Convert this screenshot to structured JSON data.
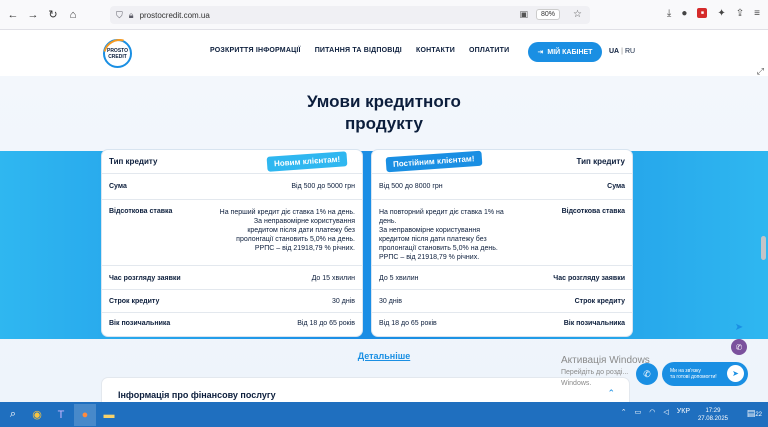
{
  "browser": {
    "url": "prostocredit.com.ua",
    "zoom": "80%"
  },
  "header": {
    "logo_line1": "PROSTO",
    "logo_line2": "CREDIT",
    "nav": [
      "РОЗКРИТТЯ ІНФОРМАЦІЇ",
      "ПИТАННЯ ТА ВІДПОВІДІ",
      "КОНТАКТИ",
      "ОПЛАТИТИ"
    ],
    "cabinet_label": "МІЙ КАБІНЕТ",
    "lang_ua": "UA",
    "lang_sep": "|",
    "lang_ru": "RU"
  },
  "main": {
    "heading_line1": "Умови кредитного",
    "heading_line2": "продукту",
    "new_clients": {
      "tag": "Новим клієнтам!",
      "rows": [
        {
          "label": "Тип кредиту",
          "value": ""
        },
        {
          "label": "Сума",
          "value": "Від 500 до 5000 грн"
        },
        {
          "label": "Відсоткова ставка",
          "value_lines": [
            "На перший кредит діє ставка 1% на день.",
            "За неправомірне користування",
            "кредитом після дати платежу без",
            "пролонгації становить 5,0% на день.",
            "РРПС – від 21918,79 % річних."
          ]
        },
        {
          "label": "Час розгляду заявки",
          "value": "До 15 хвилин"
        },
        {
          "label": "Строк кредиту",
          "value": "30 днів"
        },
        {
          "label": "Вік позичальника",
          "value": "Від 18 до 65 років"
        }
      ]
    },
    "regular_clients": {
      "tag": "Постійним клієнтам!",
      "rows": [
        {
          "label": "Тип кредиту",
          "value": ""
        },
        {
          "label": "Сума",
          "value": "Від 500 до 8000 грн"
        },
        {
          "label": "Відсоткова ставка",
          "value_lines": [
            "На повторний кредит діє ставка 1% на",
            "день.",
            "За неправомірне користування",
            "кредитом після дати платежу без",
            "пролонгації становить 5,0% на день.",
            "РРПС – від 21918,79 % річних."
          ]
        },
        {
          "label": "Час розгляду заявки",
          "value": "До 5 хвилин"
        },
        {
          "label": "Строк кредиту",
          "value": "30 днів"
        },
        {
          "label": "Вік позичальника",
          "value": "Від 18 до 65 років"
        }
      ]
    },
    "details_link": "Детальніше",
    "info_title": "Інформація про фінансову послугу"
  },
  "overlay": {
    "activate_title": "Активація Windows",
    "activate_line1": "Перейдіть до розді...",
    "activate_line2": "Windows.",
    "chat_line1": "Ми на зв'язку",
    "chat_line2": "та готові допомогти!"
  },
  "taskbar": {
    "lang": "УКР",
    "time": "17:29",
    "date": "27.08.2025",
    "notif_count": "22"
  }
}
